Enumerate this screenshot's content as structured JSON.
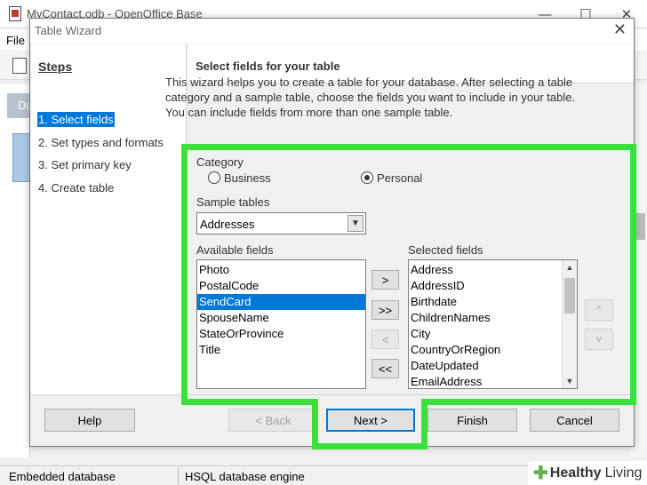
{
  "app": {
    "title": "MyContact.odb - OpenOffice Base",
    "menu_file": "File",
    "left_header": "Da",
    "window_controls": {
      "minimize": "—",
      "maximize": "☐",
      "close": "✕"
    },
    "status": {
      "left": "Embedded database",
      "engine": "HSQL database engine"
    }
  },
  "dialog": {
    "title": "Table Wizard",
    "close_glyph": "✕",
    "steps_title": "Steps",
    "steps": [
      "1. Select fields",
      "2. Set types and formats",
      "3. Set primary key",
      "4. Create table"
    ],
    "content_title": "Select fields for your table",
    "intro": "This wizard helps you to create a table for your database. After selecting a table category and a sample table, choose the fields you want to include in your table. You can include fields from more than one sample table.",
    "category_label": "Category",
    "category_options": [
      "Business",
      "Personal"
    ],
    "category_selected": "Personal",
    "sample_tables_label": "Sample tables",
    "sample_table_value": "Addresses",
    "available_label": "Available fields",
    "available_fields": [
      "Photo",
      "PostalCode",
      "SendCard",
      "SpouseName",
      "StateOrProvince",
      "Title"
    ],
    "available_selected": "SendCard",
    "selected_label": "Selected fields",
    "selected_fields": [
      "Address",
      "AddressID",
      "Birthdate",
      "ChildrenNames",
      "City",
      "CountryOrRegion",
      "DateUpdated",
      "EmailAddress"
    ],
    "move_buttons": {
      "add_one": ">",
      "add_all": ">>",
      "remove_one": "<",
      "remove_all": "<<"
    },
    "order_buttons": {
      "up": "^",
      "down": "v"
    },
    "footer": {
      "help": "Help",
      "back": "< Back",
      "next": "Next >",
      "finish": "Finish",
      "cancel": "Cancel"
    }
  },
  "watermark": {
    "brand": "Healthy",
    "brand2": "Living",
    "logo": "✚"
  },
  "colors": {
    "highlight_green": "#3ce03c",
    "selection_blue": "#0078d7"
  }
}
